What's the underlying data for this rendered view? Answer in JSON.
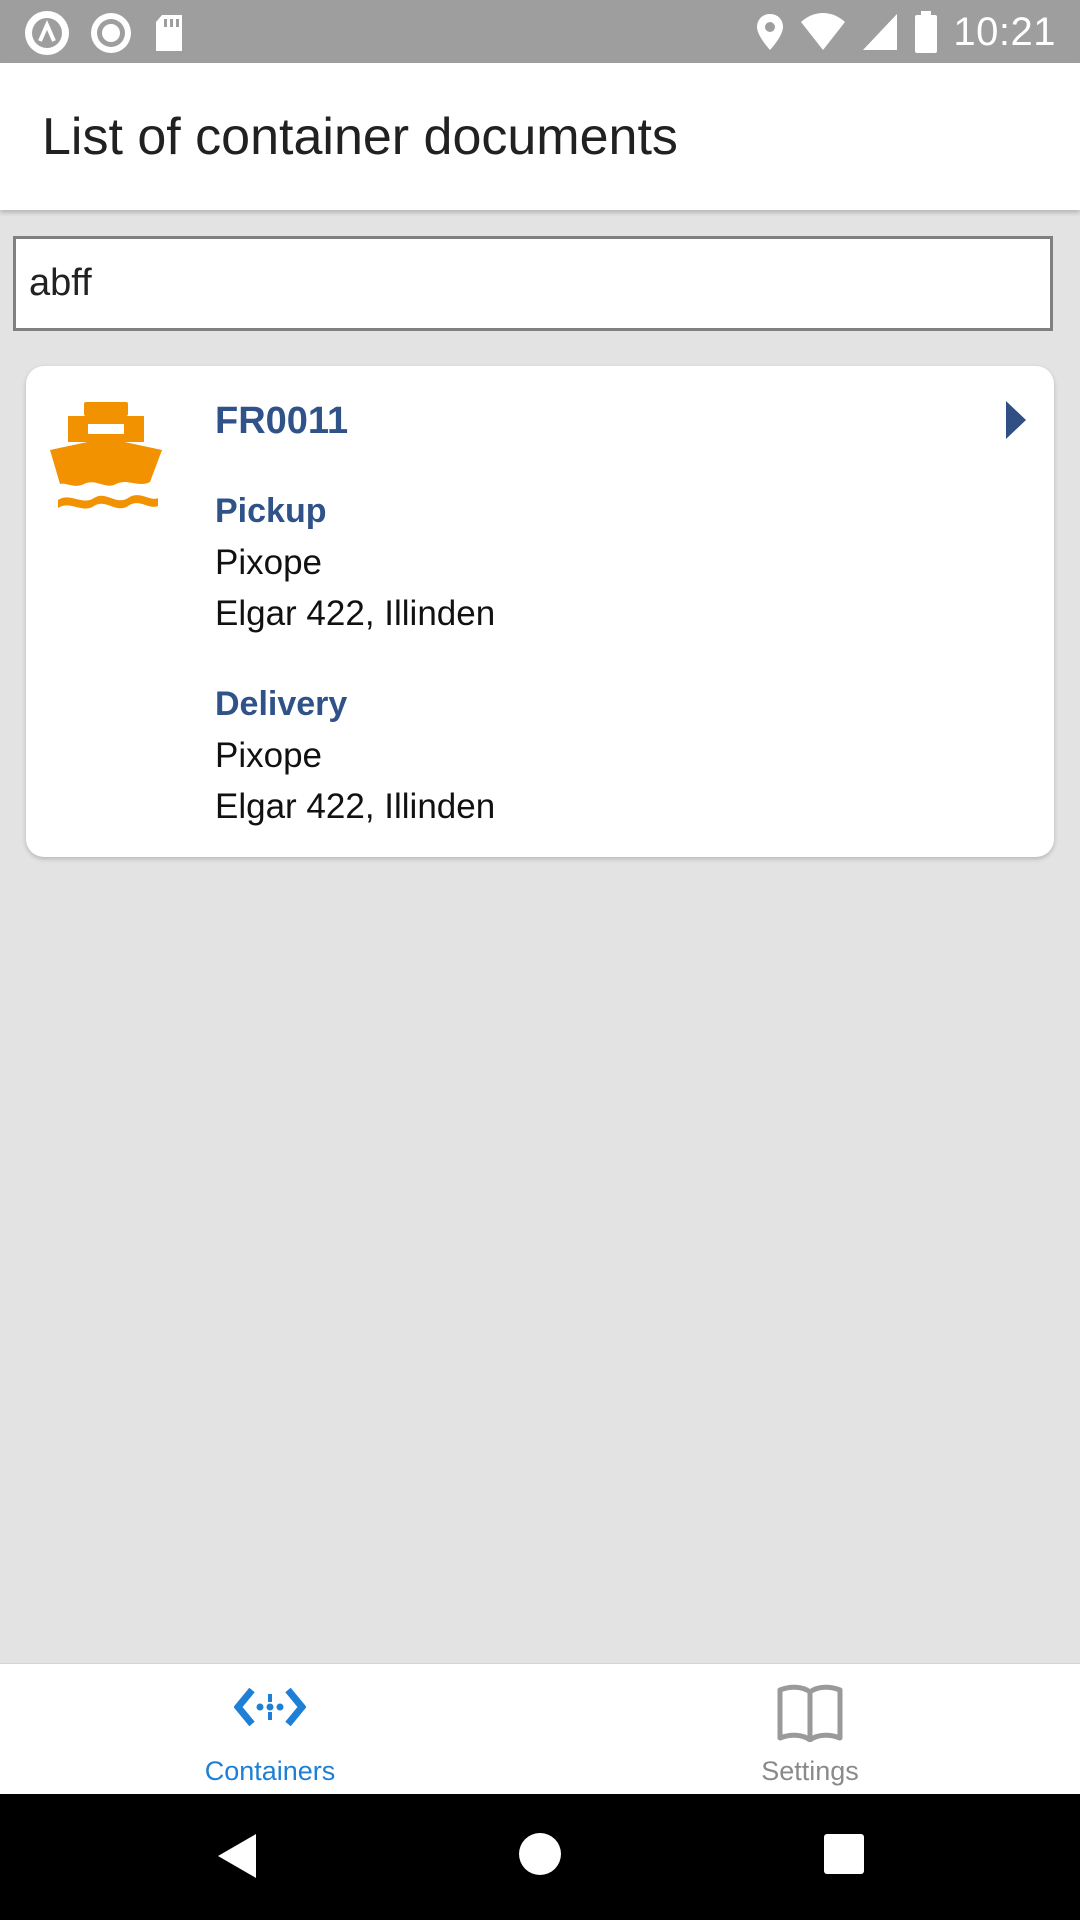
{
  "status_bar": {
    "time": "10:21",
    "left_icons": [
      "app-logo-icon",
      "record-icon",
      "sd-card-icon"
    ],
    "right_icons": [
      "location-icon",
      "wifi-icon",
      "signal-icon",
      "battery-icon"
    ]
  },
  "app_bar": {
    "title": "List of container documents"
  },
  "search": {
    "value": "abff"
  },
  "cards": [
    {
      "id": "FR0011",
      "icon": "ship-icon",
      "pickup": {
        "label": "Pickup",
        "name": "Pixope",
        "address": "Elgar 422, Illinden"
      },
      "delivery": {
        "label": "Delivery",
        "name": "Pixope",
        "address": "Elgar 422, Illinden"
      }
    }
  ],
  "bottom_nav": {
    "items": [
      {
        "label": "Containers",
        "icon": "containers-icon",
        "active": true
      },
      {
        "label": "Settings",
        "icon": "book-icon",
        "active": false
      }
    ]
  },
  "colors": {
    "accent": "#1e7fd6",
    "heading_blue": "#2f5288",
    "ship_orange": "#f39200",
    "status_bar": "#9e9e9e"
  }
}
